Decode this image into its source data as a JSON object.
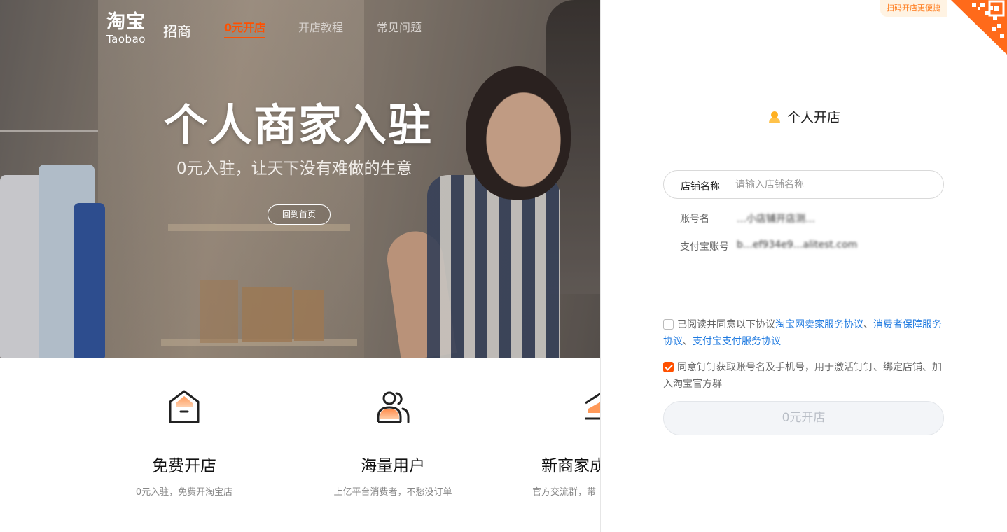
{
  "header": {
    "logo_cn": "淘宝",
    "logo_en": "Taobao",
    "logo_suffix": "招商",
    "nav": [
      "0元开店",
      "开店教程",
      "常见问题"
    ]
  },
  "hero": {
    "title": "个人商家入驻",
    "subtitle": "0元入驻，让天下没有难做的生意",
    "home_button": "回到首页"
  },
  "features": [
    {
      "icon": "shop-icon",
      "title": "免费开店",
      "desc": "0元入驻，免费开淘宝店"
    },
    {
      "icon": "users-icon",
      "title": "海量用户",
      "desc": "上亿平台消费者，不愁没订单"
    },
    {
      "icon": "stack-icon",
      "title": "新商家成",
      "desc": "官方交流群，带"
    }
  ],
  "panel": {
    "qr_tip": "扫码开店更便捷",
    "title": "个人开店",
    "shop_name_label": "店铺名称",
    "shop_name_placeholder": "请输入店铺名称",
    "account_label": "账号名",
    "account_value": "…小店铺开店测…",
    "alipay_label": "支付宝账号",
    "alipay_value": "b…ef934e9…alitest.com",
    "agreement": {
      "checked": false,
      "prefix": "已阅读并同意以下协议",
      "link1": "淘宝网卖家服务协议",
      "sep1": "、",
      "link2": "消费者保障服务协议",
      "sep2": "、",
      "link3": "支付宝支付服务协议"
    },
    "dingtalk": {
      "checked": true,
      "text": "同意钉钉获取账号名及手机号，用于激活钉钉、绑定店铺、加入淘宝官方群"
    },
    "submit_label": "0元开店"
  },
  "colors": {
    "accent": "#ff5000",
    "link": "#1f7ae0",
    "button_disabled_bg": "#f3f5f8"
  }
}
